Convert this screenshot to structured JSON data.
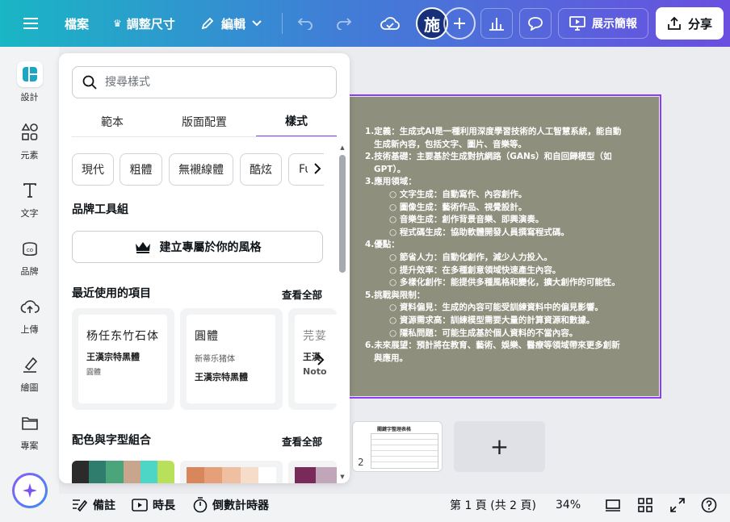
{
  "topbar": {
    "file": "檔案",
    "resize": "調整尺寸",
    "edit": "編輯",
    "avatar": "施",
    "present": "展示簡報",
    "share": "分享"
  },
  "rail": {
    "design": "設計",
    "elements": "元素",
    "text": "文字",
    "brand": "品牌",
    "uploads": "上傳",
    "draw": "繪圖",
    "projects": "專案"
  },
  "panel": {
    "search_placeholder": "搜尋樣式",
    "tabs": [
      "範本",
      "版面配置",
      "樣式"
    ],
    "chips": [
      "現代",
      "粗體",
      "無襯線體",
      "酷炫",
      "Fut"
    ],
    "brand_kit_title": "品牌工具組",
    "brand_button": "建立專屬於你的風格",
    "recent_title": "最近使用的項目",
    "see_all": "查看全部",
    "font_cards": [
      {
        "line1": "杨任东竹石体",
        "line2": "王漢宗特黑體",
        "line3": "圓體"
      },
      {
        "line1": "圓體",
        "line2": "新蒂乐猪体",
        "line3": "王漢宗特黑體"
      },
      {
        "line1": "芫荽",
        "line2": "王漢",
        "line3": "Noto"
      }
    ],
    "combos_title": "配色與字型組合",
    "palettes": [
      [
        "#2b2b2b",
        "#2f7d6d",
        "#4aa57a",
        "#c9a58e",
        "#4dd6c5",
        "#b8e05a"
      ],
      [
        "#d9875a",
        "#e5a07a",
        "#eebfa0",
        "#f5ddc9",
        "#ffffff"
      ],
      [
        "#7a2a5a",
        "#c1a5b8"
      ]
    ]
  },
  "slide": {
    "lines": [
      {
        "level": 1,
        "text": "1.定義：生成式AI是一種利用深度學習技術的人工智慧系統，能自動"
      },
      {
        "level": 1,
        "text": "   生成新內容，包括文字、圖片、音樂等。"
      },
      {
        "level": 1,
        "text": "2.技術基礎：主要基於生成對抗網路（GANs）和自回歸模型（如"
      },
      {
        "level": 1,
        "text": "   GPT）。"
      },
      {
        "level": 1,
        "text": "3.應用領域："
      },
      {
        "level": 2,
        "text": "○ 文字生成：自動寫作、內容創作。"
      },
      {
        "level": 2,
        "text": "○ 圖像生成：藝術作品、視覺設計。"
      },
      {
        "level": 2,
        "text": "○ 音樂生成：創作背景音樂、即興演奏。"
      },
      {
        "level": 2,
        "text": "○ 程式碼生成：協助軟體開發人員撰寫程式碼。"
      },
      {
        "level": 1,
        "text": "4.優點："
      },
      {
        "level": 2,
        "text": "○ 節省人力：自動化創作，減少人力投入。"
      },
      {
        "level": 2,
        "text": "○ 提升效率：在多種創意領域快速產生內容。"
      },
      {
        "level": 2,
        "text": "○ 多樣化創作：能提供多種風格和變化，擴大創作的可能性。"
      },
      {
        "level": 1,
        "text": "5.挑戰與限制："
      },
      {
        "level": 2,
        "text": "○ 資料偏見：生成的內容可能受訓練資料中的偏見影響。"
      },
      {
        "level": 2,
        "text": "○ 資源需求高：訓練模型需要大量的計算資源和數據。"
      },
      {
        "level": 2,
        "text": "○ 隱私問題：可能生成基於個人資料的不當內容。"
      },
      {
        "level": 1,
        "text": "6.未來展望：預計將在教育、藝術、娛樂、醫療等領域帶來更多創新"
      },
      {
        "level": 1,
        "text": "   與應用。"
      }
    ]
  },
  "thumbnail": {
    "number": "2",
    "title": "關鍵字整理表格"
  },
  "add_page": "+",
  "bottombar": {
    "notes": "備註",
    "duration": "時長",
    "timer": "倒數計時器",
    "page_info": "第 1 頁 (共 2 頁)",
    "zoom": "34%"
  },
  "colors": {
    "accent": "#8b3dff",
    "slide_bg": "#8f8f7e"
  }
}
